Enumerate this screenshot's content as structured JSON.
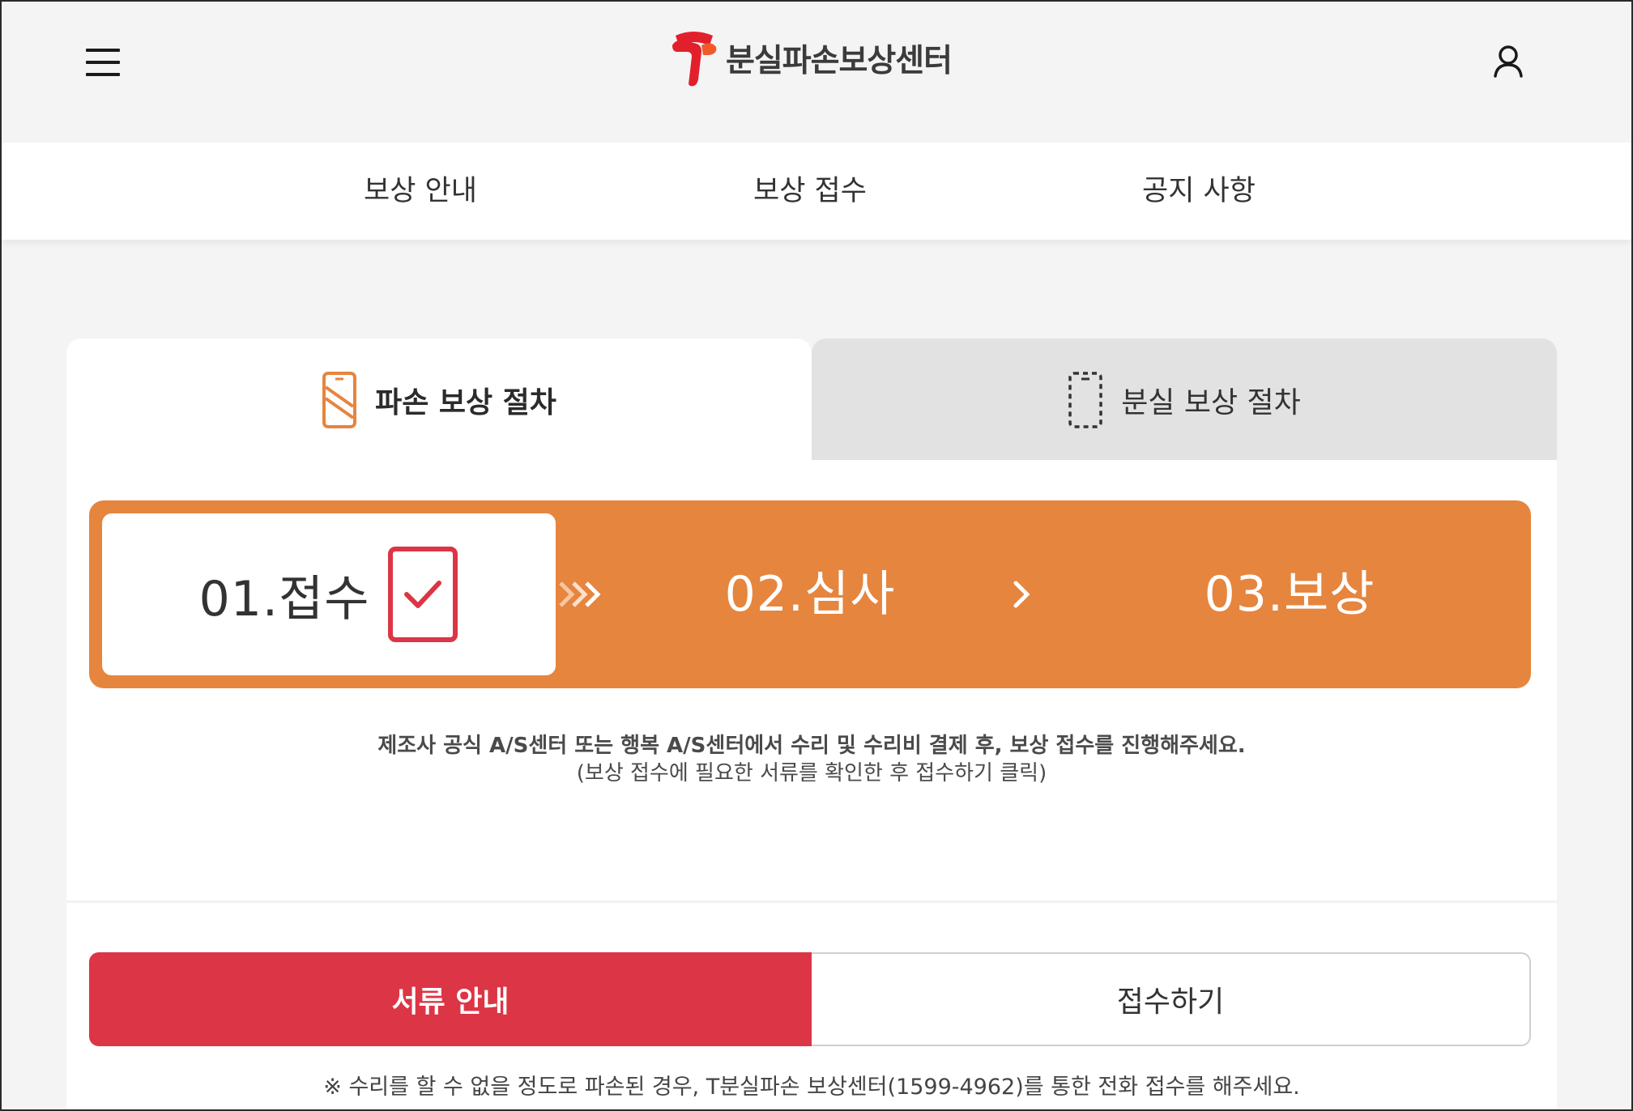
{
  "header": {
    "logo_text": "분실파손보상센터",
    "brand_color": "#e2202c"
  },
  "nav": {
    "items": [
      {
        "label": "보상 안내"
      },
      {
        "label": "보상 접수"
      },
      {
        "label": "공지 사항"
      }
    ]
  },
  "tabs": [
    {
      "label": "파손 보상 절차",
      "icon": "phone-damage-icon",
      "active": true
    },
    {
      "label": "분실 보상 절차",
      "icon": "phone-lost-icon",
      "active": false
    }
  ],
  "steps": {
    "bar_color": "#e6853e",
    "items": [
      {
        "label": "01.접수",
        "active": true,
        "icon": "checkbox-checked-icon"
      },
      {
        "label": "02.심사",
        "active": false
      },
      {
        "label": "03.보상",
        "active": false
      }
    ]
  },
  "description": {
    "main": "제조사 공식 A/S센터 또는 행복 A/S센터에서 수리 및 수리비 결제 후, 보상 접수를 진행해주세요.",
    "sub": "(보상 접수에 필요한 서류를 확인한 후 접수하기 클릭)"
  },
  "buttons": {
    "documents_label": "서류 안내",
    "submit_label": "접수하기",
    "primary_color": "#dc3545"
  },
  "note": "※ 수리를 할 수 없을 정도로 파손된 경우, T분실파손 보상센터(1599-4962)를 통한 전화 접수를 해주세요."
}
